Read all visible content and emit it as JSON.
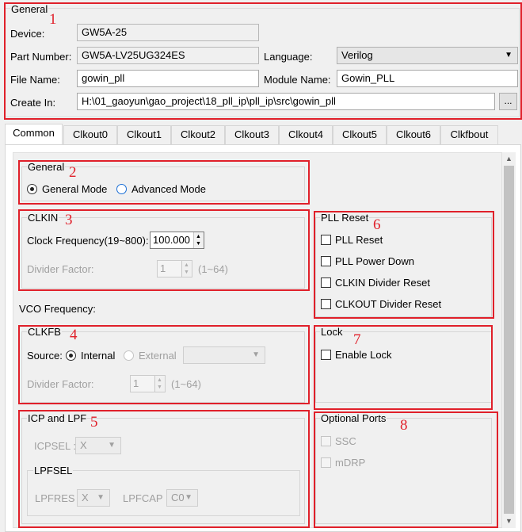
{
  "general": {
    "title": "General",
    "device_label": "Device:",
    "device_value": "GW5A-25",
    "part_number_label": "Part Number:",
    "part_number_value": "GW5A-LV25UG324ES",
    "language_label": "Language:",
    "language_value": "Verilog",
    "file_name_label": "File Name:",
    "file_name_value": "gowin_pll",
    "module_name_label": "Module Name:",
    "module_name_value": "Gowin_PLL",
    "create_in_label": "Create In:",
    "create_in_value": "H:\\01_gaoyun\\gao_project\\18_pll_ip\\pll_ip\\src\\gowin_pll",
    "browse_label": "..."
  },
  "tabs": [
    "Common",
    "Clkout0",
    "Clkout1",
    "Clkout2",
    "Clkout3",
    "Clkout4",
    "Clkout5",
    "Clkout6",
    "Clkfbout"
  ],
  "mode": {
    "title": "General",
    "general_mode": "General Mode",
    "advanced_mode": "Advanced Mode"
  },
  "clkin": {
    "title": "CLKIN",
    "clock_frequency_label": "Clock Frequency(19~800):",
    "clock_frequency_value": "100.000",
    "divider_label": "Divider Factor:",
    "divider_value": "1",
    "divider_range": "(1~64)"
  },
  "vco_label": "VCO Frequency:",
  "clkfb": {
    "title": "CLKFB",
    "source_label": "Source:",
    "internal": "Internal",
    "external": "External",
    "divider_label": "Divider Factor:",
    "divider_value": "1",
    "divider_range": "(1~64)"
  },
  "icp_lpf": {
    "title": "ICP and LPF",
    "icpsel_label": "ICPSEL :",
    "icpsel_value": "X",
    "lpfsel_title": "LPFSEL",
    "lpfres_label": "LPFRES :",
    "lpfres_value": "X",
    "lpfcap_label": "LPFCAP :",
    "lpfcap_value": "C0"
  },
  "pll_reset": {
    "title": "PLL Reset",
    "items": [
      "PLL Reset",
      "PLL Power Down",
      "CLKIN Divider Reset",
      "CLKOUT Divider Reset"
    ]
  },
  "lock": {
    "title": "Lock",
    "enable_lock": "Enable Lock"
  },
  "optional_ports": {
    "title": "Optional Ports",
    "ssc": "SSC",
    "mdrp": "mDRP"
  },
  "annotations": [
    "1",
    "2",
    "3",
    "4",
    "5",
    "6",
    "7",
    "8"
  ],
  "colors": {
    "annotation_red": "#e0202a",
    "radio_blue": "#1b6fd6",
    "panel_white": "#ffffff",
    "window_gray": "#f0f0f0"
  }
}
